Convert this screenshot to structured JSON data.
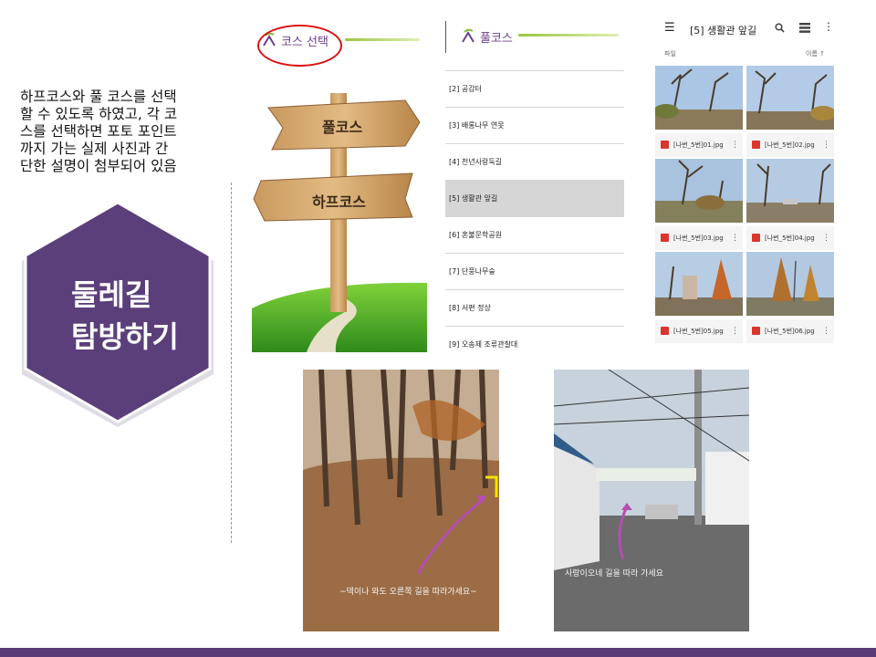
{
  "description": {
    "lines": [
      "하프코스와 풀 코스를 선택",
      "할 수 있도록 하였고, 각 코",
      "스를 선택하면 포토 포인트",
      "까지 가는 실제 사진과 간",
      "단한 설명이 첨부되어 있음"
    ]
  },
  "badge": {
    "line1": "둘레길",
    "line2": "탐방하기",
    "color": "#5b3f7a"
  },
  "course_select": {
    "title": "코스 선택",
    "sign_full": "풀코스",
    "sign_half": "하프코스"
  },
  "course_list": {
    "title": "풀코스",
    "items": [
      {
        "label": "[2] 공감터",
        "selected": false
      },
      {
        "label": "[3] 배롱나무 연못",
        "selected": false
      },
      {
        "label": "[4] 천년사랑둑길",
        "selected": false
      },
      {
        "label": "[5] 생활관 앞길",
        "selected": true
      },
      {
        "label": "[6] 혼불문학공원",
        "selected": false
      },
      {
        "label": "[7] 단풍나무숲",
        "selected": false
      },
      {
        "label": "[8] 서편 정상",
        "selected": false
      },
      {
        "label": "[9] 오송제 조류관찰대",
        "selected": false
      }
    ]
  },
  "gallery": {
    "title": "[5] 생활관 앞길",
    "subtitle": "파일",
    "sort_label": "이름 ↑",
    "files": [
      {
        "name": "[나번_5번]01.jpg"
      },
      {
        "name": "[나번_5번]02.jpg"
      },
      {
        "name": "[나번_5번]03.jpg"
      },
      {
        "name": "[나번_5번]04.jpg"
      },
      {
        "name": "[나번_5번]05.jpg"
      },
      {
        "name": "[나번_5번]06.jpg"
      }
    ]
  },
  "photos": {
    "caption1": "~덱이나 와도 오른쪽 길을 따라가세요~",
    "caption2": "사랑이오네 길을 따라 가세요"
  },
  "colors": {
    "accent": "#5b3a78",
    "highlight": "#d11111"
  }
}
